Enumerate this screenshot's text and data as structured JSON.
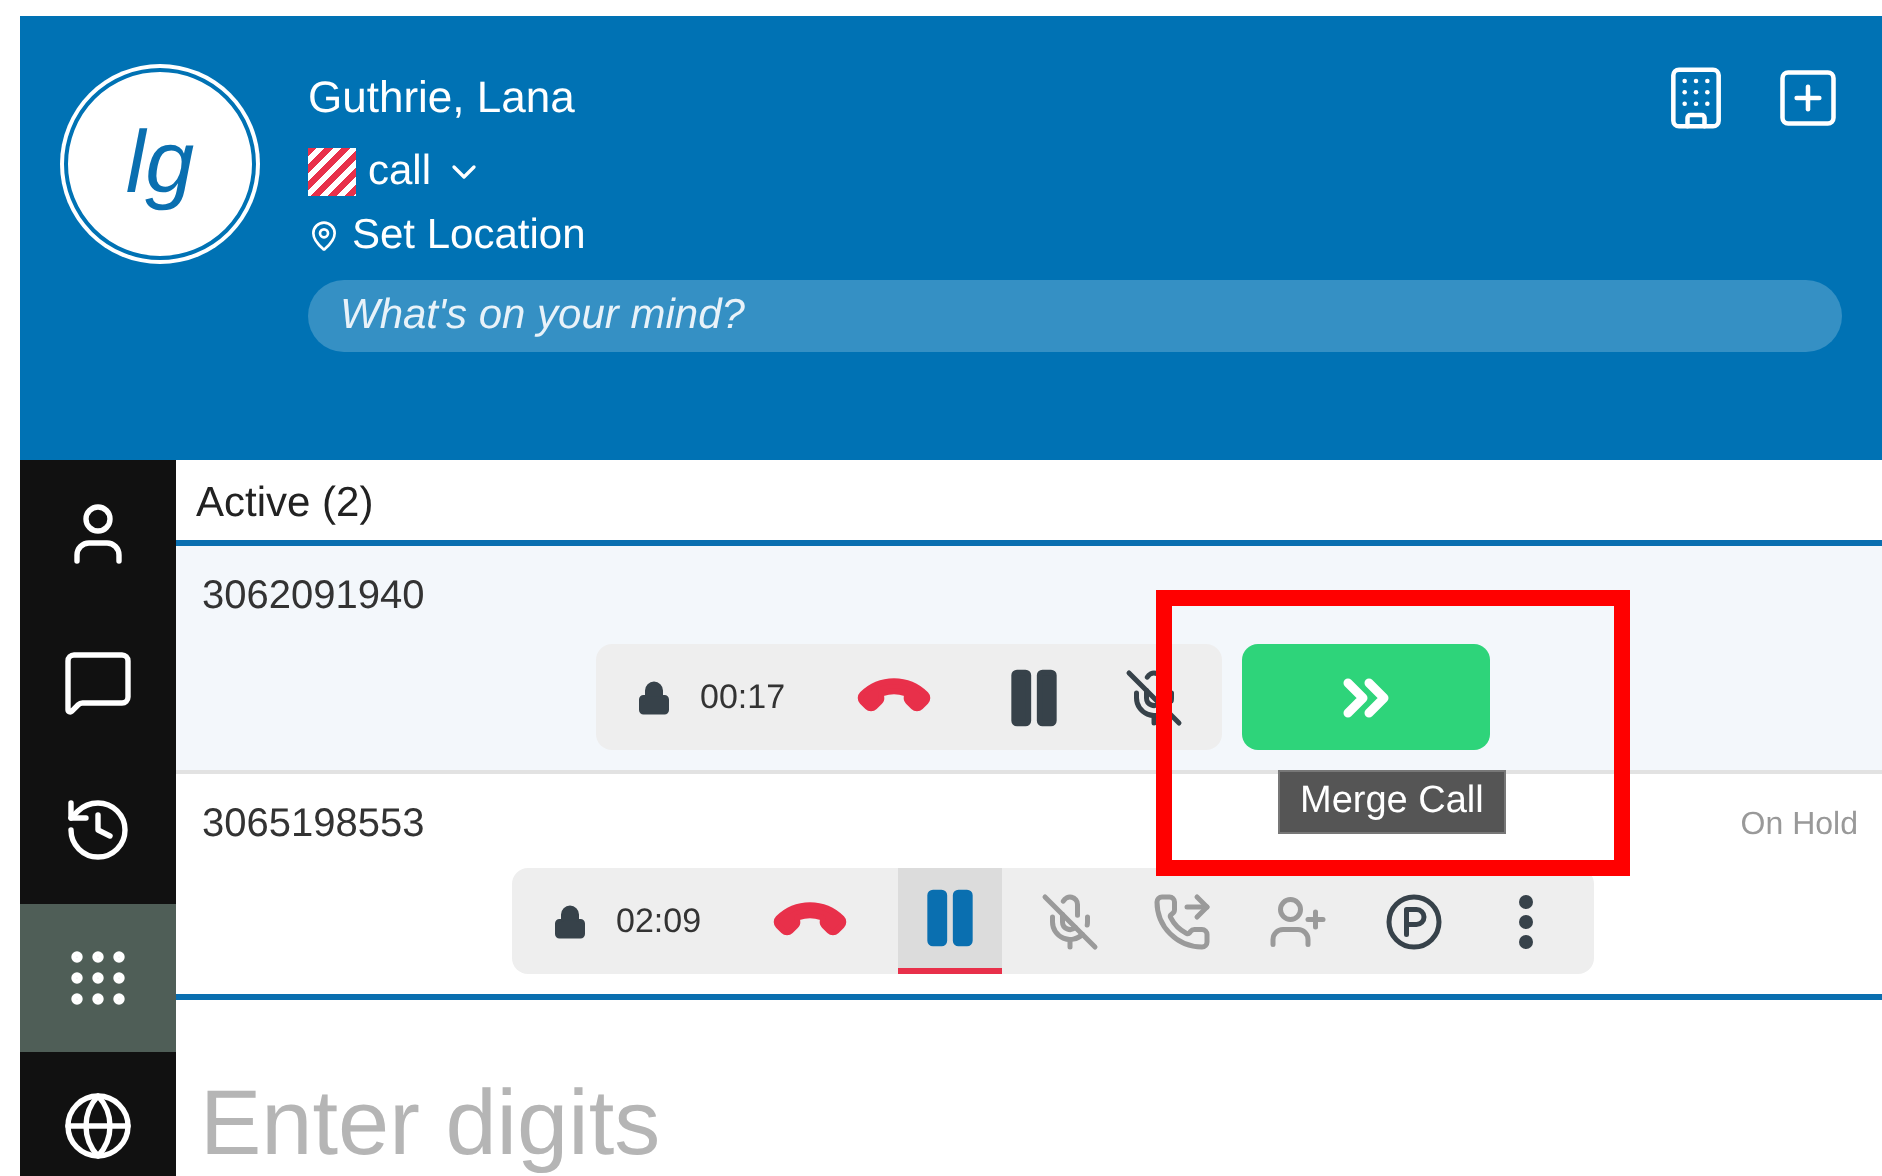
{
  "profile": {
    "initials": "lg",
    "name": "Guthrie, Lana",
    "status": "call",
    "location": "Set Location",
    "mood_placeholder": "What's on your mind?"
  },
  "header_actions": [
    {
      "kind": "building"
    },
    {
      "kind": "add"
    }
  ],
  "sidebar": {
    "items": [
      {
        "kind": "contacts",
        "selected": false
      },
      {
        "kind": "chat",
        "selected": false
      },
      {
        "kind": "history",
        "selected": false
      },
      {
        "kind": "dialpad",
        "selected": true
      },
      {
        "kind": "globe",
        "selected": false
      }
    ]
  },
  "section_title": "Active (2)",
  "calls": [
    {
      "number": "3062091940",
      "timer": "00:17",
      "highlighted": true,
      "controls": [
        {
          "kind": "hangup",
          "selected": false,
          "disabled": false
        },
        {
          "kind": "hold",
          "selected": false,
          "disabled": false
        },
        {
          "kind": "mute",
          "selected": false,
          "disabled": false
        }
      ],
      "merge": {
        "tooltip": "Merge Call"
      }
    },
    {
      "number": "3065198553",
      "timer": "02:09",
      "status": "On Hold",
      "highlighted": false,
      "controls": [
        {
          "kind": "hangup",
          "selected": false,
          "disabled": false
        },
        {
          "kind": "hold",
          "selected": true,
          "disabled": false
        },
        {
          "kind": "mute",
          "selected": false,
          "disabled": true
        },
        {
          "kind": "transfer",
          "selected": false,
          "disabled": true
        },
        {
          "kind": "add_person",
          "selected": false,
          "disabled": true
        },
        {
          "kind": "park",
          "selected": false,
          "disabled": false
        },
        {
          "kind": "more",
          "selected": false,
          "disabled": false
        }
      ]
    }
  ],
  "dial": {
    "placeholder": "Enter digits"
  }
}
